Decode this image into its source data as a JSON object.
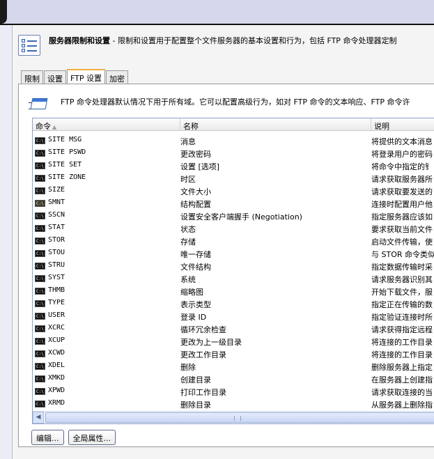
{
  "header": {
    "title": "服务器限制和设置",
    "description": " - 限制和设置用于配置整个文件服务器的基本设置和行为，包括 FTP 命令处理器定制"
  },
  "tabs": [
    {
      "label": "限制"
    },
    {
      "label": "设置"
    },
    {
      "label": "FTP 设置"
    },
    {
      "label": "加密"
    }
  ],
  "panel": {
    "description": "FTP 命令处理器默认情况下用于所有域。它可以配置高级行为，如对 FTP 命令的文本响应、FTP 命令许"
  },
  "list": {
    "columns": [
      {
        "label": "命令"
      },
      {
        "label": "名称"
      },
      {
        "label": "说明"
      }
    ],
    "rows": [
      {
        "cmd": "SITE MSG",
        "name": "消息",
        "desc": "将提供的文本消息"
      },
      {
        "cmd": "SITE PSWD",
        "name": "更改密码",
        "desc": "将登录用户的密码"
      },
      {
        "cmd": "SITE SET",
        "name": "设置 [选项]",
        "desc": "将命令中指定的钅"
      },
      {
        "cmd": "SITE ZONE",
        "name": "时区",
        "desc": "请求获取服务器所"
      },
      {
        "cmd": "SIZE",
        "name": "文件大小",
        "desc": "请求获取要发送的"
      },
      {
        "cmd": "SMNT",
        "name": "结构配置",
        "desc": "连接时配置用户他"
      },
      {
        "cmd": "SSCN",
        "name": "设置安全客户端握手 (Negotiation)",
        "desc": "指定服务器应该如"
      },
      {
        "cmd": "STAT",
        "name": "状态",
        "desc": "要求获取当前文件"
      },
      {
        "cmd": "STOR",
        "name": "存储",
        "desc": "启动文件传输，使"
      },
      {
        "cmd": "STOU",
        "name": "唯一存储",
        "desc": "与 STOR 命令类似"
      },
      {
        "cmd": "STRU",
        "name": "文件结构",
        "desc": "指定数据传输时采"
      },
      {
        "cmd": "SYST",
        "name": "系统",
        "desc": "请求服务器识别其"
      },
      {
        "cmd": "THMB",
        "name": "缩略图",
        "desc": "开始下载文件，服"
      },
      {
        "cmd": "TYPE",
        "name": "表示类型",
        "desc": "指定正在传输的数"
      },
      {
        "cmd": "USER",
        "name": "登录 ID",
        "desc": "指定验证连接时所"
      },
      {
        "cmd": "XCRC",
        "name": "循环冗余检查",
        "desc": "请求获得指定远程"
      },
      {
        "cmd": "XCUP",
        "name": "更改为上一级目录",
        "desc": "将连接的工作目录"
      },
      {
        "cmd": "XCWD",
        "name": "更改工作目录",
        "desc": "将连接的工作目录"
      },
      {
        "cmd": "XDEL",
        "name": "删除",
        "desc": "删除服务器上指定"
      },
      {
        "cmd": "XMKD",
        "name": "创建目录",
        "desc": "在服务器上创建指"
      },
      {
        "cmd": "XPWD",
        "name": "打印工作目录",
        "desc": "请求获取连接的当"
      },
      {
        "cmd": "XRMD",
        "name": "删除目录",
        "desc": "从服务器上删除指"
      }
    ]
  },
  "buttons": {
    "edit": "编辑...",
    "global": "全局属性..."
  }
}
